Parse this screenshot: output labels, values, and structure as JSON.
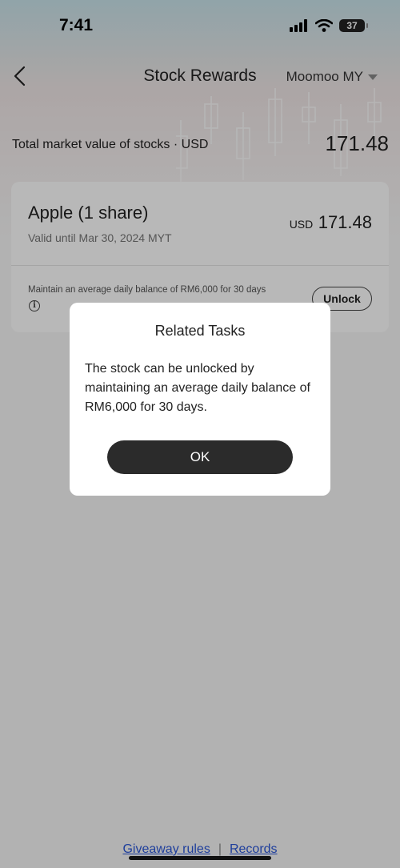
{
  "status_bar": {
    "time": "7:41",
    "battery": "37",
    "icons": [
      "signal-icon",
      "wifi-icon",
      "battery-icon"
    ]
  },
  "nav": {
    "title": "Stock Rewards",
    "account": "Moomoo MY",
    "icons": [
      "back-chevron-icon",
      "caret-down-icon"
    ]
  },
  "summary": {
    "label": "Total market value of stocks · USD",
    "value": "171.48"
  },
  "reward_card": {
    "stock_name": "Apple",
    "shares": "(1 share)",
    "valid_until": "Valid until Mar 30, 2024 MYT",
    "currency": "USD",
    "amount": "171.48",
    "task_text": "Maintain an average daily balance of RM6,000 for 30 days",
    "unlock_label": "Unlock"
  },
  "dialog": {
    "title": "Related Tasks",
    "body": "The stock can be unlocked by maintaining an average daily balance of RM6,000 for 30 days.",
    "ok_label": "OK"
  },
  "footer": {
    "rules_link": "Giveaway rules",
    "separator": "|",
    "records_link": "Records",
    "link_color": "#2a57d9"
  },
  "colors": {
    "overlay": "rgba(0,0,0,0.28)",
    "primary_button": "#2b2b2b"
  }
}
